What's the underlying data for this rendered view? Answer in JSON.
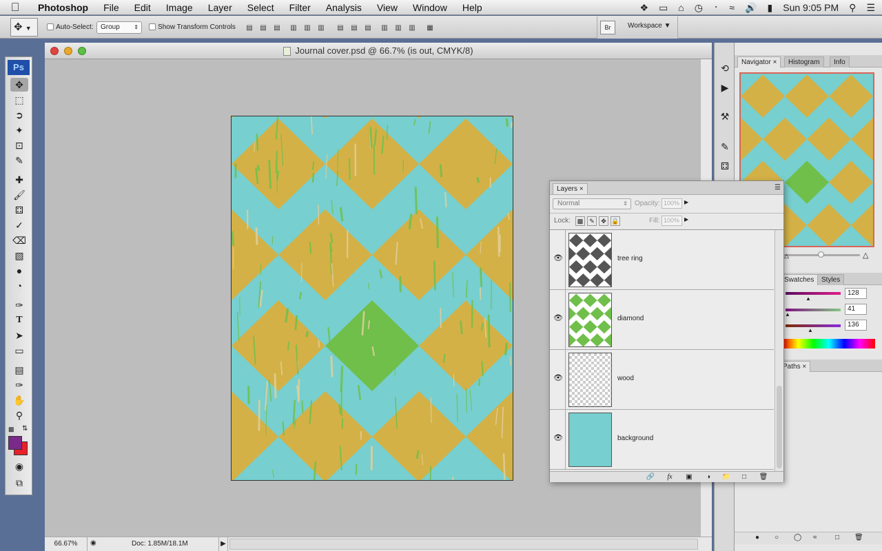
{
  "menubar": {
    "apple": "",
    "items": [
      "Photoshop",
      "File",
      "Edit",
      "Image",
      "Layer",
      "Select",
      "Filter",
      "Analysis",
      "View",
      "Window",
      "Help"
    ],
    "clock": "Sun 9:05 PM"
  },
  "options": {
    "auto_select_label": "Auto-Select:",
    "auto_select_value": "Group",
    "show_transform_label": "Show Transform Controls",
    "workspace_label": "Workspace"
  },
  "document": {
    "title": "Journal cover.psd @ 66.7% (is out, CMYK/8)",
    "zoom": "66.67%",
    "doc_size": "Doc: 1.85M/18.1M",
    "colors": {
      "aqua": "#77cfcf",
      "gold": "#d3b146",
      "green": "#6fbf4a",
      "pale": "#e0cf9a"
    }
  },
  "toolbox": {
    "logo": "Ps",
    "fg_color": "#7a2a8a",
    "bg_color": "#e8202a"
  },
  "navigator": {
    "tabs": [
      "Navigator",
      "Histogram",
      "Info"
    ]
  },
  "color_panel": {
    "tabs": [
      "Swatches",
      "Styles"
    ],
    "values": [
      "128",
      "41",
      "136"
    ]
  },
  "paths_panel": {
    "tab": "Paths"
  },
  "layers": {
    "tab": "Layers",
    "blend_mode": "Normal",
    "opacity_label": "Opacity:",
    "opacity_value": "100%",
    "lock_label": "Lock:",
    "fill_label": "Fill:",
    "fill_value": "100%",
    "items": [
      {
        "name": "tree ring"
      },
      {
        "name": "diamond"
      },
      {
        "name": "wood"
      },
      {
        "name": "background"
      }
    ]
  }
}
